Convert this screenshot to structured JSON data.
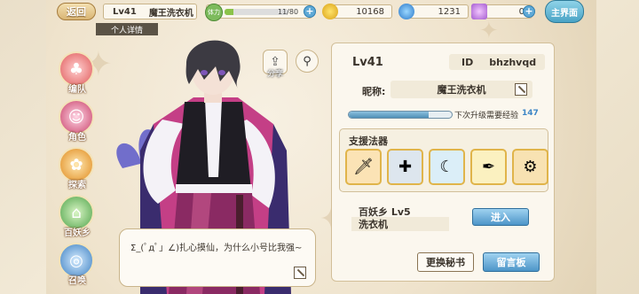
{
  "topbar": {
    "back_label": "返回",
    "level": "Lv41",
    "player_name": "魔王洗衣机",
    "stamina_label": "体力",
    "stamina_text": "11/80",
    "stamina_fraction": 0.1375,
    "gold": "10168",
    "gems": "1231",
    "tickets": "0",
    "main_label": "主界面"
  },
  "profile_tab": "个人详情",
  "sidenav": {
    "items": [
      {
        "label": "编队",
        "icon": "team-icon"
      },
      {
        "label": "角色",
        "icon": "character-icon"
      },
      {
        "label": "探索",
        "icon": "explore-icon"
      },
      {
        "label": "百妖乡",
        "icon": "village-icon"
      },
      {
        "label": "召唤",
        "icon": "summon-icon"
      }
    ]
  },
  "share_label": "分享",
  "speech": "Σ_(ﾟдﾟ」∠)扎心摸仙，为什么小号比我强~",
  "panel": {
    "level": "Lv41",
    "id_label": "ID",
    "id_value": "bhzhvqd",
    "nick_label": "昵称:",
    "nick_value": "魔王洗衣机",
    "exp_fraction": 0.78,
    "exp_text": "下次升级需要经验",
    "exp_value": "147",
    "support_title": "支援法器",
    "tools": [
      "red-sword-icon",
      "crossbow-icon",
      "ice-blade-icon",
      "golden-pen-icon",
      "purple-cannon-icon"
    ],
    "realm_title": "百妖乡  Lv5",
    "realm_name": "洗衣机",
    "enter_label": "进入",
    "change_secretary": "更换秘书",
    "message_board": "留言板"
  },
  "colors": {
    "accent_blue": "#4d95c8",
    "panel_bg": "#fbf7ee",
    "gold_border": "#e0b44a"
  }
}
